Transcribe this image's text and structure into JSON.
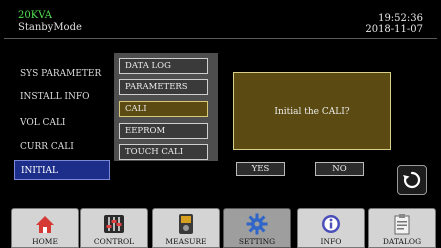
{
  "header": {
    "model": "20KVA",
    "mode": "StanbyMode",
    "time": "19:52:36",
    "date": "2018-11-07"
  },
  "left_menu": {
    "items": [
      {
        "label": "SYS PARAMETER"
      },
      {
        "label": "INSTALL INFO"
      },
      {
        "label": "VOL CALI"
      },
      {
        "label": "CURR CALI"
      },
      {
        "label": "INITIAL",
        "selected": true
      }
    ]
  },
  "submenu": {
    "items": [
      {
        "label": "DATA LOG"
      },
      {
        "label": "PARAMETERS"
      },
      {
        "label": "CALI",
        "selected": true
      },
      {
        "label": "EEPROM"
      },
      {
        "label": "TOUCH CALI"
      }
    ]
  },
  "dialog": {
    "message": "Initial the CALI?",
    "yes_label": "YES",
    "no_label": "NO"
  },
  "nav": {
    "tabs": [
      {
        "label": "HOME",
        "icon": "home-icon"
      },
      {
        "label": "CONTROL",
        "icon": "sliders-icon"
      },
      {
        "label": "MEASURE",
        "icon": "meter-icon"
      },
      {
        "label": "SETTING",
        "icon": "gear-icon",
        "active": true
      },
      {
        "label": "INFO",
        "icon": "info-icon"
      },
      {
        "label": "DATALOG",
        "icon": "clipboard-icon"
      }
    ]
  },
  "colors": {
    "model_text": "#4fe04f",
    "selected_left": "#1c2e8a",
    "selected_sub": "#5b4b12",
    "dialog_bg": "#5b4b12"
  }
}
